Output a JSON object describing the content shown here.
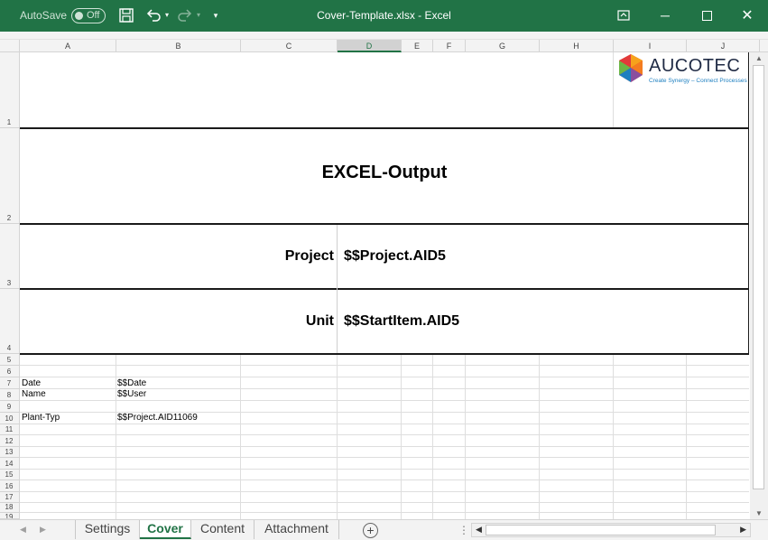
{
  "titlebar": {
    "autosave_label": "AutoSave",
    "autosave_state": "Off",
    "title": "Cover-Template.xlsx  -  Excel",
    "icons": [
      "save-icon",
      "undo-icon",
      "redo-icon",
      "customize-qat-icon",
      "ribbon-display-icon",
      "minimize-icon",
      "maximize-icon",
      "close-icon"
    ]
  },
  "columns": [
    "A",
    "B",
    "C",
    "D",
    "E",
    "F",
    "G",
    "H",
    "I",
    "J"
  ],
  "selected_column": "D",
  "rows": [
    "1",
    "2",
    "3",
    "4",
    "5",
    "6",
    "7",
    "8",
    "9",
    "10",
    "11",
    "12",
    "13",
    "14",
    "15",
    "16",
    "17",
    "18",
    "19"
  ],
  "logo": {
    "word": "AUCOTEC",
    "tagline": "Create Synergy – Connect Processes"
  },
  "sheet": {
    "title": "EXCEL-Output",
    "project_label": "Project",
    "project_value": "$$Project.AID5",
    "unit_label": "Unit",
    "unit_value": "$$StartItem.AID5",
    "date_label": "Date",
    "date_value": "$$Date",
    "name_label": "Name",
    "name_value": "$$User",
    "plant_label": "Plant-Typ",
    "plant_value": "$$Project.AID11069"
  },
  "tabs": {
    "settings": "Settings",
    "cover": "Cover",
    "content": "Content",
    "attachment": "Attachment"
  },
  "active_tab": "Cover",
  "colors": {
    "excel_green": "#217346",
    "logo_blue": "#1d7fc0"
  }
}
